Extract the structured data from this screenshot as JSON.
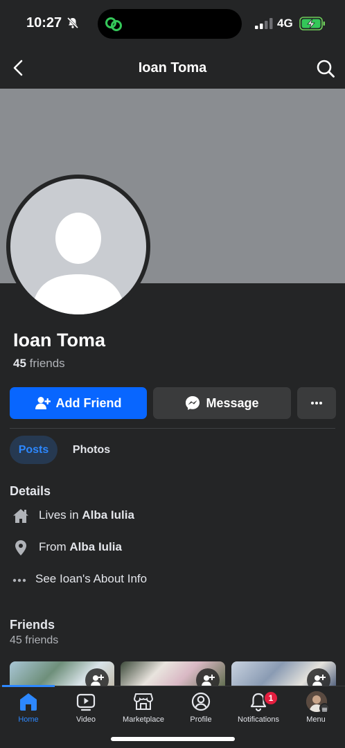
{
  "status": {
    "time": "10:27",
    "network": "4G"
  },
  "header": {
    "title": "Ioan Toma"
  },
  "profile": {
    "name": "Ioan Toma",
    "friend_count": "45",
    "friends_word": "friends"
  },
  "actions": {
    "add_friend": "Add Friend",
    "message": "Message",
    "more": "..."
  },
  "tabs": [
    {
      "label": "Posts",
      "active": true
    },
    {
      "label": "Photos",
      "active": false
    }
  ],
  "details": {
    "heading": "Details",
    "lives_prefix": "Lives in ",
    "lives_value": "Alba Iulia",
    "from_prefix": "From ",
    "from_value": "Alba Iulia",
    "about": "See Ioan's About Info"
  },
  "friends_section": {
    "heading": "Friends",
    "count_text": "45 friends"
  },
  "bottom_nav": [
    {
      "label": "Home",
      "icon": "home-icon",
      "active": true
    },
    {
      "label": "Video",
      "icon": "video-icon",
      "active": false
    },
    {
      "label": "Marketplace",
      "icon": "marketplace-icon",
      "active": false
    },
    {
      "label": "Profile",
      "icon": "profile-icon",
      "active": false
    },
    {
      "label": "Notifications",
      "icon": "bell-icon",
      "active": false,
      "badge": "1"
    },
    {
      "label": "Menu",
      "icon": "menu-avatar-icon",
      "active": false
    }
  ],
  "colors": {
    "accent": "#0866ff",
    "active_tab_text": "#2d88ff",
    "badge": "#e41e3f",
    "background": "#242526"
  }
}
